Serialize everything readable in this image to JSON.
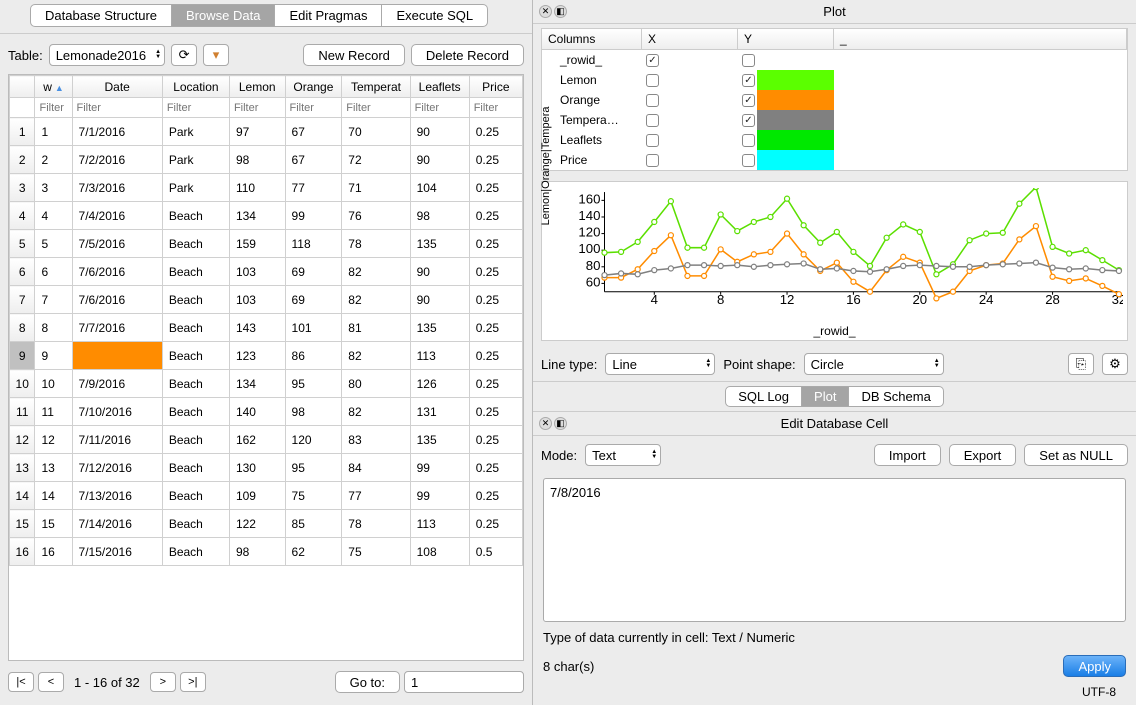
{
  "tabs": [
    "Database Structure",
    "Browse Data",
    "Edit Pragmas",
    "Execute SQL"
  ],
  "active_tab": 1,
  "table_label": "Table:",
  "table_select": "Lemonade2016",
  "btn_new_record": "New Record",
  "btn_delete_record": "Delete Record",
  "columns": [
    "w",
    "Date",
    "Location",
    "Lemon",
    "Orange",
    "Tempera",
    "Leaflets",
    "Price"
  ],
  "column_headers": [
    "w",
    "Date",
    "Location",
    "Lemon",
    "Orange",
    "Temperat",
    "Leaflets",
    "Price"
  ],
  "filter_placeholder": "Filter",
  "rows": [
    [
      1,
      "7/1/2016",
      "Park",
      97,
      67,
      70,
      90,
      0.25
    ],
    [
      2,
      "7/2/2016",
      "Park",
      98,
      67,
      72,
      90,
      0.25
    ],
    [
      3,
      "7/3/2016",
      "Park",
      110,
      77,
      71,
      104,
      0.25
    ],
    [
      4,
      "7/4/2016",
      "Beach",
      134,
      99,
      76,
      98,
      0.25
    ],
    [
      5,
      "7/5/2016",
      "Beach",
      159,
      118,
      78,
      135,
      0.25
    ],
    [
      6,
      "7/6/2016",
      "Beach",
      103,
      69,
      82,
      90,
      0.25
    ],
    [
      7,
      "7/6/2016",
      "Beach",
      103,
      69,
      82,
      90,
      0.25
    ],
    [
      8,
      "7/7/2016",
      "Beach",
      143,
      101,
      81,
      135,
      0.25
    ],
    [
      9,
      "",
      "Beach",
      123,
      86,
      82,
      113,
      0.25
    ],
    [
      10,
      "7/9/2016",
      "Beach",
      134,
      95,
      80,
      126,
      0.25
    ],
    [
      11,
      "7/10/2016",
      "Beach",
      140,
      98,
      82,
      131,
      0.25
    ],
    [
      12,
      "7/11/2016",
      "Beach",
      162,
      120,
      83,
      135,
      0.25
    ],
    [
      13,
      "7/12/2016",
      "Beach",
      130,
      95,
      84,
      99,
      0.25
    ],
    [
      14,
      "7/13/2016",
      "Beach",
      109,
      75,
      77,
      99,
      0.25
    ],
    [
      15,
      "7/14/2016",
      "Beach",
      122,
      85,
      78,
      113,
      0.25
    ],
    [
      16,
      "7/15/2016",
      "Beach",
      98,
      62,
      75,
      108,
      0.5
    ]
  ],
  "selected_row_index": 8,
  "highlight_cell": {
    "row": 8,
    "col": 1
  },
  "nav": {
    "first": "|<",
    "prev": "<",
    "status": "1 - 16 of 32",
    "next": ">",
    "last": ">|",
    "goto_label": "Go to:",
    "goto_value": "1"
  },
  "plot_panel": {
    "title": "Plot",
    "col_header": [
      "Columns",
      "X",
      "Y",
      "_"
    ],
    "rows": [
      {
        "name": "_rowid_",
        "x": true,
        "y": false,
        "color": null
      },
      {
        "name": "Lemon",
        "x": false,
        "y": true,
        "color": "#5bff00"
      },
      {
        "name": "Orange",
        "x": false,
        "y": true,
        "color": "#ff8c00"
      },
      {
        "name": "Tempera…",
        "x": false,
        "y": true,
        "color": "#808080"
      },
      {
        "name": "Leaflets",
        "x": false,
        "y": false,
        "color": "#00e800"
      },
      {
        "name": "Price",
        "x": false,
        "y": false,
        "color": "#00ffff"
      }
    ],
    "line_type_label": "Line type:",
    "line_type": "Line",
    "point_shape_label": "Point shape:",
    "point_shape": "Circle"
  },
  "chart_data": {
    "type": "line",
    "xlabel": "_rowid_",
    "ylabel": "Lemon|Orange|Tempera",
    "xlim": [
      1,
      32
    ],
    "ylim": [
      50,
      170
    ],
    "xticks": [
      4,
      8,
      12,
      16,
      20,
      24,
      28,
      32
    ],
    "yticks": [
      60,
      80,
      100,
      120,
      140,
      160
    ],
    "series": [
      {
        "name": "Lemon",
        "color": "#5bdf00",
        "values": [
          97,
          98,
          110,
          134,
          159,
          103,
          103,
          143,
          123,
          134,
          140,
          162,
          130,
          109,
          122,
          98,
          81,
          115,
          131,
          122,
          71,
          83,
          112,
          120,
          121,
          156,
          176,
          104,
          96,
          100,
          88,
          76
        ]
      },
      {
        "name": "Orange",
        "color": "#ff8c00",
        "values": [
          67,
          67,
          77,
          99,
          118,
          69,
          69,
          101,
          86,
          95,
          98,
          120,
          95,
          75,
          85,
          62,
          50,
          76,
          92,
          85,
          42,
          50,
          75,
          82,
          84,
          113,
          129,
          68,
          63,
          66,
          57,
          47
        ]
      },
      {
        "name": "Temperature",
        "color": "#808080",
        "values": [
          70,
          72,
          71,
          76,
          78,
          82,
          82,
          81,
          82,
          80,
          82,
          83,
          84,
          77,
          78,
          75,
          74,
          77,
          81,
          82,
          81,
          80,
          80,
          82,
          83,
          84,
          85,
          79,
          77,
          78,
          76,
          75
        ]
      }
    ]
  },
  "subtabs": [
    "SQL Log",
    "Plot",
    "DB Schema"
  ],
  "subtab_active": 1,
  "edit_panel": {
    "title": "Edit Database Cell",
    "mode_label": "Mode:",
    "mode": "Text",
    "import": "Import",
    "export": "Export",
    "set_null": "Set as NULL",
    "value": "7/8/2016",
    "type_line": "Type of data currently in cell: Text / Numeric",
    "chars": "8 char(s)",
    "apply": "Apply",
    "encoding": "UTF-8"
  }
}
